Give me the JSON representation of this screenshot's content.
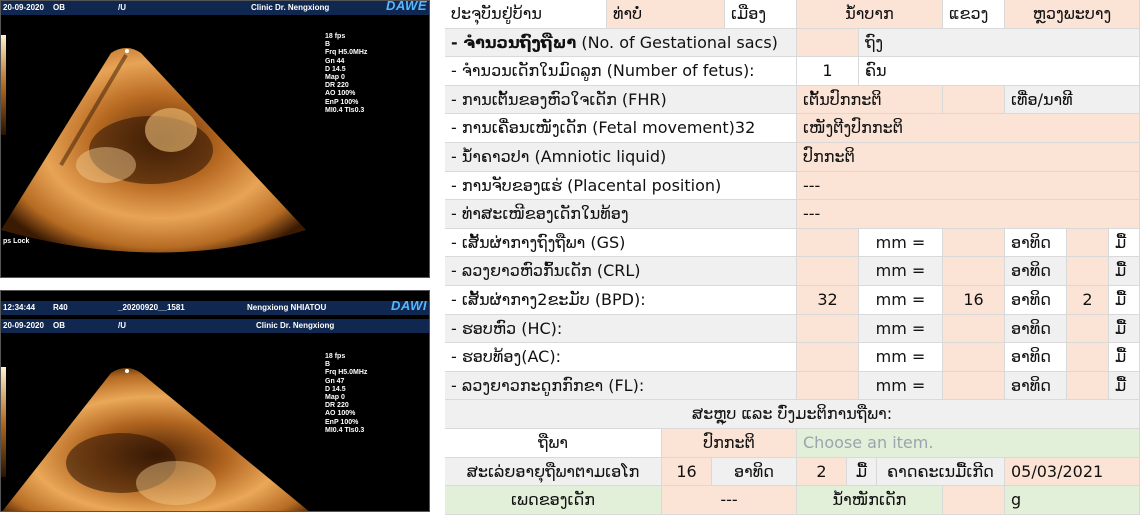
{
  "ultrasound_top": {
    "date": "20-09-2020",
    "mode": "OB",
    "slash": "/U",
    "clinic": "Clinic Dr. Nengxiong",
    "logo": "DAWE",
    "params": [
      "18 fps",
      "B",
      "Frq  H5.0MHz",
      "Gn  44",
      "D    14.5",
      "Map 0",
      "DR   220",
      "AO  100%",
      "EnP 100%",
      "MI0.4  TIs0.3"
    ],
    "footer": "ps Lock"
  },
  "ultrasound_bottom": {
    "time": "12:34:44",
    "probe": "R40",
    "file": "_20200920__1581",
    "patient": "Nengxiong NHIATOU",
    "logo": "DAWI",
    "date": "20-09-2020",
    "mode": "OB",
    "slash": "/U",
    "clinic": "Clinic Dr. Nengxiong",
    "params": [
      "18 fps",
      "B",
      "Frq  H5.0MHz",
      "Gn  47",
      "D    14.5",
      "Map 0",
      "DR   220",
      "AO  100%",
      "EnP 100%",
      "MI0.4  TIs0.3"
    ]
  },
  "form": {
    "address": {
      "label": "ປະຈຸບັນຢູ່ບ້ານ",
      "village": "ທ່າບໍ່",
      "district_label": "ເມືອງ",
      "district": "ນໍ້າບາກ",
      "province_label": "ແຂວງ",
      "province": "ຫຼວງພະບາງ"
    },
    "rows": [
      {
        "label": "- ຈໍານວນຖົງຖືພາ",
        "label_en": " (No. of Gestational sacs)",
        "unit": "ຖົງ",
        "value": ""
      },
      {
        "label": "- ຈໍານວນເດັກໃນມົດລູກ  (Number of fetus):",
        "value": "1",
        "unit": "ຄົນ"
      },
      {
        "label": "- ການເຕັ້ນຂອງຫົວໃຈເດັກ  (FHR)",
        "value": "ເຕັ້ນປົກກະຕິ",
        "unit": "ເທື່ອ/ນາທີ"
      },
      {
        "label": "- ການເຄື່ອນເໜັງເດັກ (Fetal movement)32",
        "value": "ເໜັງຕີງປົກກະຕິ"
      },
      {
        "label": "- ນໍ້າຄາວປາ (Amniotic liquid)",
        "value": "ປົກກະຕິ"
      },
      {
        "label": "- ການຈັບຂອງແຮ່  (Placental position)",
        "value": "---"
      },
      {
        "label": "- ທ່າສະເໜີຂອງເດັກໃນທ້ອງ",
        "value": "---"
      }
    ],
    "measurements": [
      {
        "label": "- ເສັ້ນຜ່າກາງຖົງຖືພາ (GS)",
        "value": "",
        "mm": "mm =",
        "weeks": "",
        "weeks_label": "ອາທິດ",
        "days": "",
        "days_label": "ມື້"
      },
      {
        "label": "- ລວງຍາວຫົວກົ້ນເດັກ (CRL)",
        "value": "",
        "mm": "mm =",
        "weeks": "",
        "weeks_label": "ອາທິດ",
        "days": "",
        "days_label": "ມື້"
      },
      {
        "label": "- ເສັ້ນຜ່າກາງ2ຂະມັບ (BPD):",
        "value": "32",
        "mm": "mm =",
        "weeks": "16",
        "weeks_label": "ອາທິດ",
        "days": "2",
        "days_label": "ມື້"
      },
      {
        "label": "- ຮອບຫົວ (HC):",
        "value": "",
        "mm": "mm =",
        "weeks": "",
        "weeks_label": "ອາທິດ",
        "days": "",
        "days_label": "ມື້"
      },
      {
        "label": "- ຮອບທ້ອງ(AC):",
        "value": "",
        "mm": "mm =",
        "weeks": "",
        "weeks_label": "ອາທິດ",
        "days": "",
        "days_label": "ມື້"
      },
      {
        "label": "- ລວງຍາວກະດູກກົກຂາ (FL):",
        "value": "",
        "mm": "mm =",
        "weeks": "",
        "weeks_label": "ອາທິດ",
        "days": "",
        "days_label": "ມື້"
      }
    ],
    "summary_title": "ສະຫຼຸບ ແລະ ບົ່ງມະຕິການຖືພາ:",
    "pregnancy_label": "ຖືພາ",
    "pregnancy_value": "ປົກກະຕິ",
    "choose_placeholder": "Choose an item.",
    "ga_label": "ສະເລ່ຍອາຍຸຖືພາຕາມເອໂກ",
    "ga_weeks": "16",
    "ga_weeks_label": "ອາທິດ",
    "ga_days": "2",
    "ga_days_label": "ມື້",
    "edd_label": "ຄາດຄະເນມື້ເກີດ",
    "edd_value": "05/03/2021",
    "sex_label": "ເພດຂອງເດັກ",
    "sex_value": "---",
    "weight_label": "ນໍ້າໜັກເດັກ",
    "weight_unit": "g"
  },
  "colors": {
    "peach": "#fbe3d5",
    "green": "#e2efd9",
    "grey": "#f0f0f0",
    "header_blue": "#10284f"
  }
}
